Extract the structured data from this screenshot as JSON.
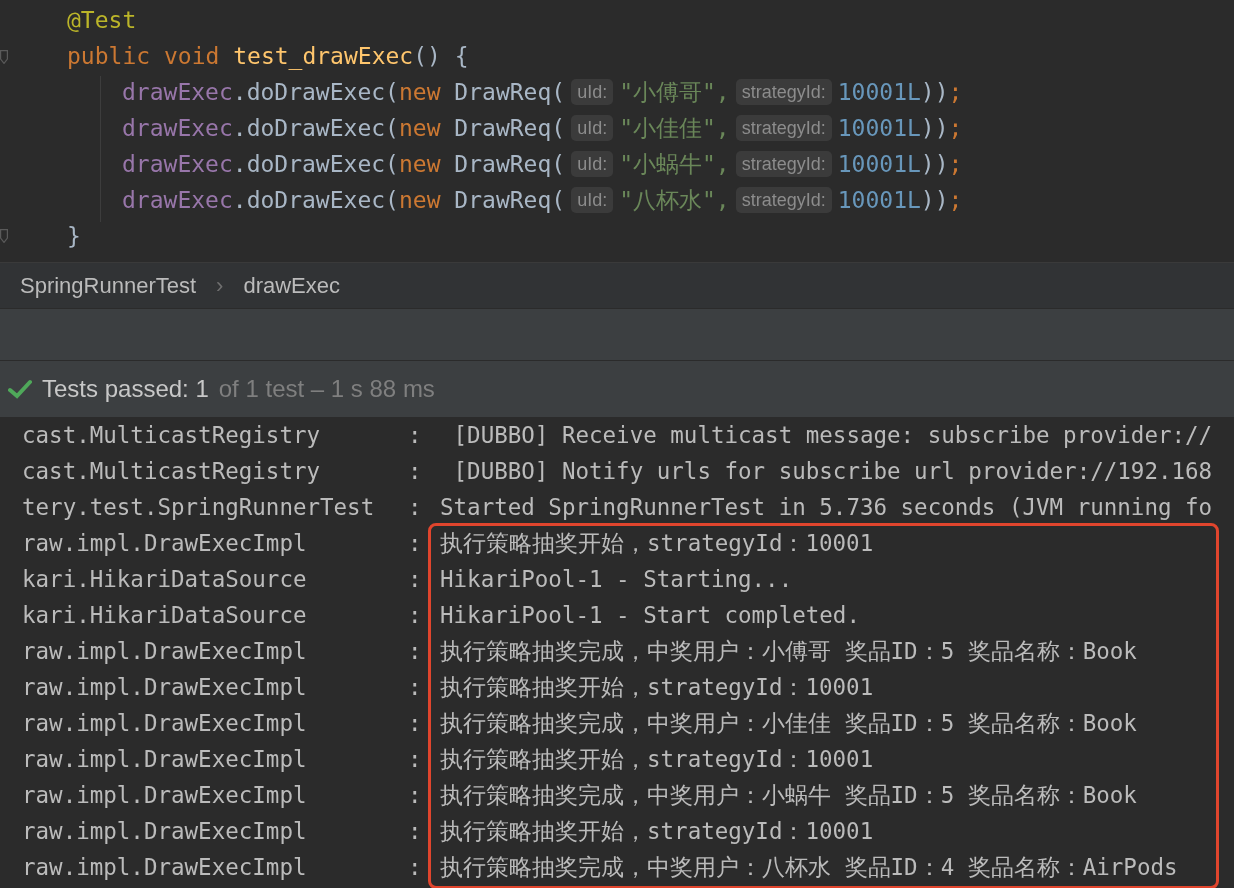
{
  "code": {
    "annotation": "@Test",
    "signature": [
      {
        "kind": "keyword",
        "text": "public "
      },
      {
        "kind": "keyword",
        "text": "void "
      },
      {
        "kind": "method",
        "text": "test_drawExec"
      },
      {
        "kind": "plain",
        "text": "() {"
      }
    ],
    "body": [
      {
        "tokens": [
          {
            "kind": "field",
            "text": "drawExec"
          },
          {
            "kind": "plain",
            "text": ".doDrawExec("
          },
          {
            "kind": "keyword",
            "text": "new "
          },
          {
            "kind": "plain",
            "text": "DrawReq("
          },
          {
            "kind": "hint",
            "text": "uId:"
          },
          {
            "kind": "string",
            "text": "\"小傅哥\","
          },
          {
            "kind": "hint",
            "text": "strategyId:"
          },
          {
            "kind": "number",
            "text": "10001L"
          },
          {
            "kind": "plain",
            "text": "))"
          },
          {
            "kind": "keyword",
            "text": ";"
          }
        ]
      },
      {
        "tokens": [
          {
            "kind": "field",
            "text": "drawExec"
          },
          {
            "kind": "plain",
            "text": ".doDrawExec("
          },
          {
            "kind": "keyword",
            "text": "new "
          },
          {
            "kind": "plain",
            "text": "DrawReq("
          },
          {
            "kind": "hint",
            "text": "uId:"
          },
          {
            "kind": "string",
            "text": "\"小佳佳\","
          },
          {
            "kind": "hint",
            "text": "strategyId:"
          },
          {
            "kind": "number",
            "text": "10001L"
          },
          {
            "kind": "plain",
            "text": "))"
          },
          {
            "kind": "keyword",
            "text": ";"
          }
        ]
      },
      {
        "tokens": [
          {
            "kind": "field",
            "text": "drawExec"
          },
          {
            "kind": "plain",
            "text": ".doDrawExec("
          },
          {
            "kind": "keyword",
            "text": "new "
          },
          {
            "kind": "plain",
            "text": "DrawReq("
          },
          {
            "kind": "hint",
            "text": "uId:"
          },
          {
            "kind": "string",
            "text": "\"小蜗牛\","
          },
          {
            "kind": "hint",
            "text": "strategyId:"
          },
          {
            "kind": "number",
            "text": "10001L"
          },
          {
            "kind": "plain",
            "text": "))"
          },
          {
            "kind": "keyword",
            "text": ";"
          }
        ]
      },
      {
        "tokens": [
          {
            "kind": "field",
            "text": "drawExec"
          },
          {
            "kind": "plain",
            "text": ".doDrawExec("
          },
          {
            "kind": "keyword",
            "text": "new "
          },
          {
            "kind": "plain",
            "text": "DrawReq("
          },
          {
            "kind": "hint",
            "text": "uId:"
          },
          {
            "kind": "string",
            "text": "\"八杯水\","
          },
          {
            "kind": "hint",
            "text": "strategyId:"
          },
          {
            "kind": "number",
            "text": "10001L"
          },
          {
            "kind": "plain",
            "text": "))"
          },
          {
            "kind": "keyword",
            "text": ";"
          }
        ]
      }
    ],
    "closing": "}"
  },
  "breadcrumb": {
    "items": [
      "SpringRunnerTest",
      "drawExec"
    ],
    "separator": "›"
  },
  "test_status": {
    "passed": true,
    "summary": "Tests passed: 1",
    "detail": "of 1 test – 1 s 88 ms"
  },
  "log": [
    {
      "logger": "cast.MulticastRegistry",
      "separator": ":",
      "message": " [DUBBO] Receive multicast message: subscribe provider://"
    },
    {
      "logger": "cast.MulticastRegistry",
      "separator": ":",
      "message": " [DUBBO] Notify urls for subscribe url provider://192.168"
    },
    {
      "logger": "tery.test.SpringRunnerTest",
      "separator": ":",
      "message": "Started SpringRunnerTest in 5.736 seconds (JVM running fo"
    }
  ],
  "highlighted_log": [
    {
      "logger": "raw.impl.DrawExecImpl",
      "separator": ":",
      "message": "执行策略抽奖开始，strategyId：10001"
    },
    {
      "logger": "kari.HikariDataSource",
      "separator": ":",
      "message": "HikariPool-1 - Starting..."
    },
    {
      "logger": "kari.HikariDataSource",
      "separator": ":",
      "message": "HikariPool-1 - Start completed."
    },
    {
      "logger": "raw.impl.DrawExecImpl",
      "separator": ":",
      "message": "执行策略抽奖完成，中奖用户：小傅哥 奖品ID：5 奖品名称：Book"
    },
    {
      "logger": "raw.impl.DrawExecImpl",
      "separator": ":",
      "message": "执行策略抽奖开始，strategyId：10001"
    },
    {
      "logger": "raw.impl.DrawExecImpl",
      "separator": ":",
      "message": "执行策略抽奖完成，中奖用户：小佳佳 奖品ID：5 奖品名称：Book"
    },
    {
      "logger": "raw.impl.DrawExecImpl",
      "separator": ":",
      "message": "执行策略抽奖开始，strategyId：10001"
    },
    {
      "logger": "raw.impl.DrawExecImpl",
      "separator": ":",
      "message": "执行策略抽奖完成，中奖用户：小蜗牛 奖品ID：5 奖品名称：Book"
    },
    {
      "logger": "raw.impl.DrawExecImpl",
      "separator": ":",
      "message": "执行策略抽奖开始，strategyId：10001"
    },
    {
      "logger": "raw.impl.DrawExecImpl",
      "separator": ":",
      "message": "执行策略抽奖完成，中奖用户：八杯水 奖品ID：4 奖品名称：AirPods"
    }
  ]
}
